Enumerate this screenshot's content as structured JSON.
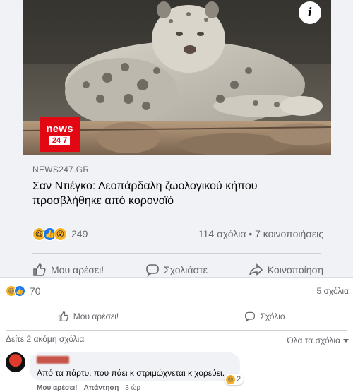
{
  "shared_post": {
    "info_icon": "i",
    "logo": {
      "line1": "news",
      "line2a": "24",
      "line2b": "7"
    },
    "source": "NEWS247.GR",
    "title": "Σαν Ντιέγκο: Λεοπάρδαλη ζωολογικού κήπου προσβλήθηκε από κορονοϊό",
    "reaction_icons": [
      "haha-emoji",
      "like-icon",
      "wow-emoji"
    ],
    "reaction_count": "249",
    "comments_shares": "114 σχόλια • 7 κοινοποιήσεις",
    "actions": {
      "like": "Μου αρέσει!",
      "comment": "Σχολιάστε",
      "share": "Κοινοποίηση"
    }
  },
  "post": {
    "reaction_icons": [
      "haha-emoji",
      "like-icon"
    ],
    "reaction_count": "70",
    "comments_count": "5 σχόλια",
    "actions": {
      "like": "Μου αρέσει!",
      "comment": "Σχόλιο"
    }
  },
  "comments_bar": {
    "more": "Δείτε 2 ακόμη σχόλια",
    "sort": "Όλα τα σχόλια"
  },
  "comment": {
    "text": "Από τα πάρτυ, που πάει κ στριμώχνεται κ χορεύει.",
    "reaction_count": "2",
    "like_link": "Μου αρέσει!",
    "separator": "·",
    "reply_link": "Απάντηση",
    "time": "3 ώρ"
  },
  "colors": {
    "brand_red": "#e30613",
    "fb_blue": "#1877f2",
    "reaction_yellow": "#f7b125"
  }
}
